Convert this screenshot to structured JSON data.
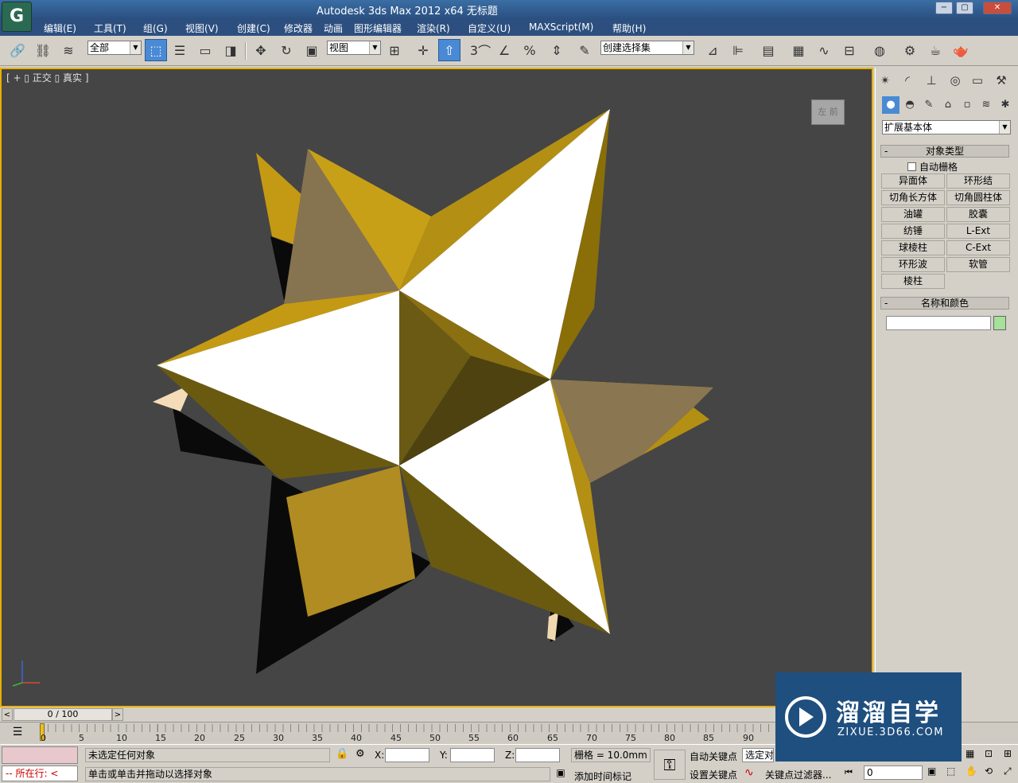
{
  "window": {
    "title": "Autodesk 3ds Max  2012 x64     无标题",
    "logo_glyph": "G",
    "buttons": [
      "−",
      "▢",
      "✕"
    ]
  },
  "menu": [
    "编辑(E)",
    "工具(T)",
    "组(G)",
    "视图(V)",
    "创建(C)",
    "修改器",
    "动画",
    "图形编辑器",
    "渲染(R)",
    "自定义(U)",
    "MAXScript(M)",
    "帮助(H)"
  ],
  "toolbar": {
    "selection_filter": "全部",
    "reference_coord": "视图",
    "named_selection": "创建选择集",
    "snap_label": "3",
    "percent_label": "%"
  },
  "viewport": {
    "label": "[ + ▯ 正交 ▯ 真实 ]",
    "viewcube_label": "左 前",
    "colors": {
      "border": "#e8b000",
      "background": "#454545",
      "gold": "#c49a14",
      "white": "#ffffff"
    }
  },
  "panel": {
    "dropdown": "扩展基本体",
    "object_type_title": "对象类型",
    "auto_grid": "自动栅格",
    "objects": [
      "异面体",
      "环形结",
      "切角长方体",
      "切角圆柱体",
      "油罐",
      "胶囊",
      "纺锤",
      "L-Ext",
      "球棱柱",
      "C-Ext",
      "环形波",
      "软管",
      "棱柱"
    ],
    "name_color_title": "名称和颜色",
    "name_value": "",
    "swatch_color": "#a6e09a"
  },
  "timeline": {
    "slider_label": "0 / 100",
    "ticks": [
      "0",
      "5",
      "10",
      "15",
      "20",
      "25",
      "30",
      "35",
      "40",
      "45",
      "50",
      "55",
      "60",
      "65",
      "70",
      "75",
      "80",
      "85",
      "90"
    ]
  },
  "status": {
    "running": "所在行:",
    "selection_msg": "未选定任何对象",
    "prompt_msg": "单击或单击并拖动以选择对象",
    "x_label": "X:",
    "y_label": "Y:",
    "z_label": "Z:",
    "grid": "栅格 = 10.0mm",
    "add_time_tag": "添加时间标记",
    "auto_key": "自动关键点",
    "set_key": "设置关键点",
    "selected_dropdown": "选定对",
    "key_filters": "关键点过滤器...",
    "frame_value": "0"
  },
  "watermark": {
    "title": "溜溜自学",
    "subtitle": "ZIXUE.3D66.COM"
  }
}
